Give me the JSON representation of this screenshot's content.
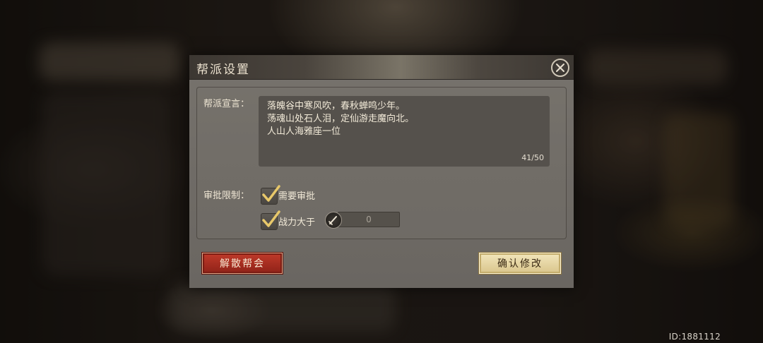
{
  "background": {
    "id_text": "ID:1881112"
  },
  "dialog": {
    "title": "帮派设置",
    "declaration": {
      "label": "帮派宣言：",
      "lines": [
        "落魄谷中寒风吹，春秋蝉鸣少年。",
        "荡魂山处石人泪，定仙游走魔向北。",
        "人山人海雅座一位"
      ],
      "count": "41/50"
    },
    "approval": {
      "label": "审批限制：",
      "options": [
        {
          "label": "需要审批",
          "checked": true
        },
        {
          "label": "战力大于",
          "checked": true
        }
      ],
      "power_value": "0"
    },
    "buttons": {
      "disband": "解散帮会",
      "confirm": "确认修改"
    }
  },
  "colors": {
    "disband_red": "#b0301f",
    "confirm_gold": "#e8d8a4",
    "check_gold": "#e8c86a"
  },
  "icons": [
    "close-icon",
    "checkmark-icon",
    "power-icon"
  ]
}
